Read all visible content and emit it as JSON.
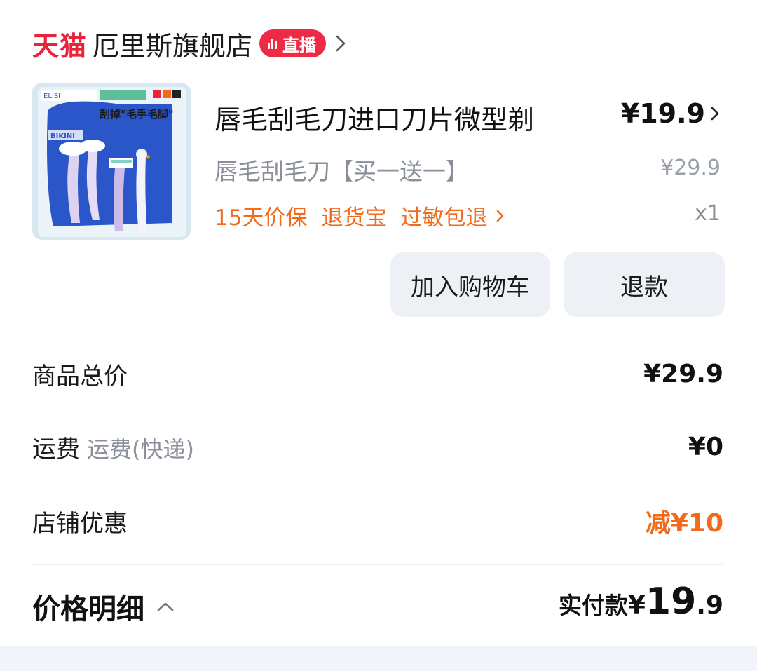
{
  "store": {
    "platform": "天猫",
    "name": "厄里斯旗舰店",
    "live_label": "直播"
  },
  "product": {
    "title": "唇毛刮毛刀进口刀片微型剃",
    "price": "¥19.9",
    "spec": "唇毛刮毛刀【买一送一】",
    "original_price": "¥29.9",
    "quantity": "x1",
    "services": [
      "15天价保",
      "退货宝",
      "过敏包退"
    ],
    "image_texts": {
      "brand": "ELISI",
      "slogan": "刮掉\"毛手毛脚\"",
      "bikini": "BIKINI"
    }
  },
  "actions": {
    "add_to_cart": "加入购物车",
    "refund": "退款"
  },
  "summary": {
    "goods_total_label": "商品总价",
    "goods_total_value": "¥29.9",
    "shipping_label": "运费",
    "shipping_sub": "运费(快递)",
    "shipping_value": "¥0",
    "store_discount_label": "店铺优惠",
    "store_discount_value": "减¥10"
  },
  "footer": {
    "detail_label": "价格明细",
    "paid_label": "实付款",
    "paid_currency": "¥",
    "paid_int": "19",
    "paid_dec": ".9"
  },
  "colors": {
    "tmall_red": "#e8233a",
    "service_orange": "#f26b1d",
    "button_bg": "#edf1f6"
  }
}
